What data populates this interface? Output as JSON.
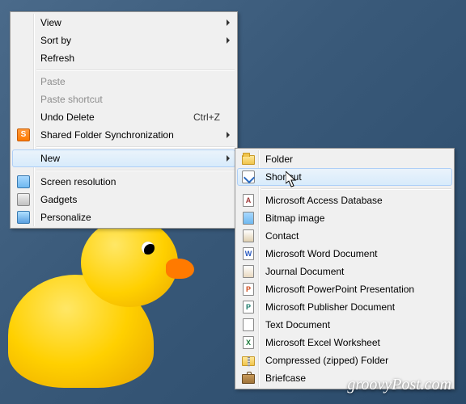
{
  "contextMenu": {
    "view": {
      "label": "View",
      "hasSubmenu": true
    },
    "sortBy": {
      "label": "Sort by",
      "hasSubmenu": true
    },
    "refresh": {
      "label": "Refresh"
    },
    "paste": {
      "label": "Paste",
      "disabled": true
    },
    "pasteShort": {
      "label": "Paste shortcut",
      "disabled": true
    },
    "undo": {
      "label": "Undo Delete",
      "accel": "Ctrl+Z"
    },
    "sharedSync": {
      "label": "Shared Folder Synchronization",
      "hasSubmenu": true,
      "icon": "s-icon"
    },
    "new": {
      "label": "New",
      "hasSubmenu": true,
      "highlighted": true
    },
    "screenRes": {
      "label": "Screen resolution",
      "icon": "screen-icon"
    },
    "gadgets": {
      "label": "Gadgets",
      "icon": "gadget-icon"
    },
    "personalize": {
      "label": "Personalize",
      "icon": "personalize-icon"
    }
  },
  "newSubmenu": {
    "folder": {
      "label": "Folder",
      "icon": "folder-icon"
    },
    "shortcut": {
      "label": "Shortcut",
      "icon": "shortcut-icon",
      "highlighted": true
    },
    "access": {
      "label": "Microsoft Access Database",
      "icon": "access-icon",
      "letter": "A",
      "color": "#a03a3a"
    },
    "bitmap": {
      "label": "Bitmap image",
      "icon": "bitmap-icon",
      "letter": "",
      "color": "#4a8ac0"
    },
    "contact": {
      "label": "Contact",
      "icon": "contact-icon",
      "letter": "",
      "color": "#888"
    },
    "word": {
      "label": "Microsoft Word Document",
      "icon": "word-icon",
      "letter": "W",
      "color": "#2a5ac0"
    },
    "journal": {
      "label": "Journal Document",
      "icon": "journal-icon",
      "letter": "",
      "color": "#8a6a4a"
    },
    "ppt": {
      "label": "Microsoft PowerPoint Presentation",
      "icon": "ppt-icon",
      "letter": "P",
      "color": "#d04a1a"
    },
    "publisher": {
      "label": "Microsoft Publisher Document",
      "icon": "pub-icon",
      "letter": "P",
      "color": "#1a7a6a"
    },
    "text": {
      "label": "Text Document",
      "icon": "text-icon",
      "letter": "",
      "color": "#888"
    },
    "excel": {
      "label": "Microsoft Excel Worksheet",
      "icon": "excel-icon",
      "letter": "X",
      "color": "#1a7a3a"
    },
    "zip": {
      "label": "Compressed (zipped) Folder",
      "icon": "zip-icon"
    },
    "briefcase": {
      "label": "Briefcase",
      "icon": "briefcase-icon"
    }
  },
  "watermark": "groovyPost.com"
}
